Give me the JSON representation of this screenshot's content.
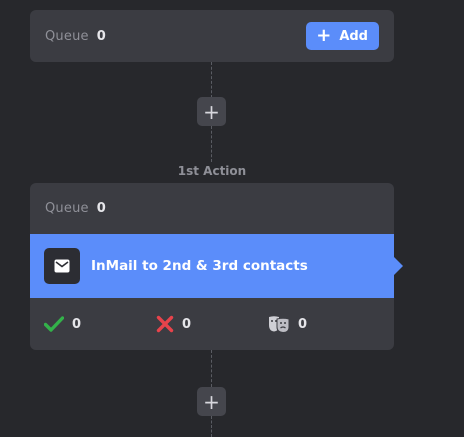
{
  "queue_card": {
    "label": "Queue",
    "count": "0",
    "add_button": {
      "icon": "plus-icon",
      "label": "Add"
    }
  },
  "plus_nodes": [
    {
      "label": "+",
      "icon": "plus-icon"
    },
    {
      "label": "+",
      "icon": "plus-icon"
    }
  ],
  "action_step": {
    "step_label": "1st Action",
    "queue_label": "Queue",
    "queue_count": "0",
    "action": {
      "icon": "envelope-icon",
      "title": "InMail to 2nd & 3rd contacts"
    },
    "stats": [
      {
        "icon": "checkmark-icon",
        "value": "0",
        "color": "#33b24a"
      },
      {
        "icon": "x-mark-icon",
        "value": "0",
        "color": "#e8434b"
      },
      {
        "icon": "theater-masks-icon",
        "value": "0",
        "color": "#cfcfd5"
      }
    ]
  },
  "colors": {
    "background": "#27282c",
    "card": "#3b3c42",
    "accent": "#5b8dfa",
    "node": "#45464d"
  }
}
